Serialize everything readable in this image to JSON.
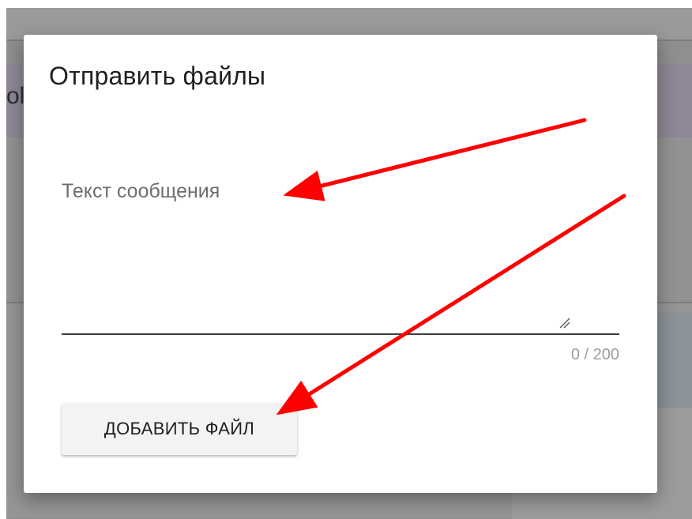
{
  "background": {
    "peek_text": "ol"
  },
  "dialog": {
    "title": "Отправить файлы",
    "message_field": {
      "label": "Текст сообщения",
      "value": "",
      "counter": "0 / 200"
    },
    "add_file_label": "ДОБАВИТЬ ФАЙЛ"
  },
  "annotations": {
    "arrow_color": "#ff0000",
    "count": 2
  },
  "colors": {
    "dialog_bg": "#ffffff",
    "button_bg": "#f3f3f3",
    "backdrop": "#8f8f8f"
  }
}
